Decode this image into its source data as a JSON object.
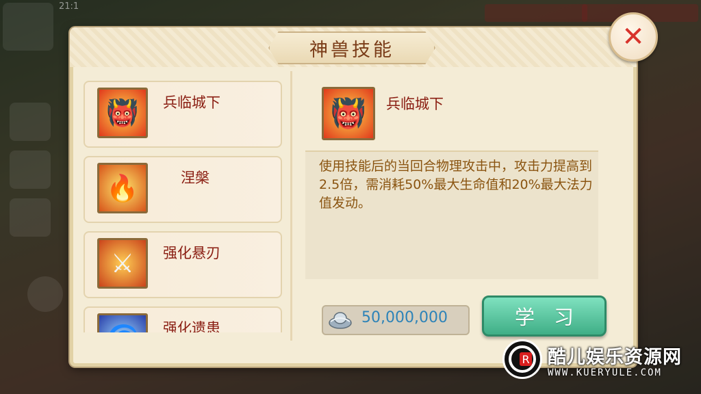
{
  "hud": {
    "time": "21:1"
  },
  "dialog": {
    "title": "神兽技能",
    "close_symbol": "✕"
  },
  "skills": [
    {
      "name": "兵临城下",
      "icon": "fire-demon-icon",
      "glyph": "👹"
    },
    {
      "name": "涅槃",
      "icon": "phoenix-icon",
      "glyph": "🔥"
    },
    {
      "name": "强化悬刃",
      "icon": "swords-icon",
      "glyph": "⚔"
    },
    {
      "name": "强化遗患",
      "icon": "blue-vortex-icon",
      "glyph": "🌀"
    }
  ],
  "detail": {
    "name": "兵临城下",
    "icon": "fire-demon-icon",
    "glyph": "👹",
    "description": "使用技能后的当回合物理攻击中，攻击力提高到2.5倍，需消耗50%最大生命值和20%最大法力值发动。"
  },
  "cost": {
    "icon": "silver-ingot-icon",
    "value": "50,000,000"
  },
  "learn_button": "学习",
  "watermark": {
    "title": "酷儿娱乐资源网",
    "url": "WWW.KUERYULE.COM",
    "logo_letter": "R"
  },
  "colors": {
    "accent_red": "#8a1e12",
    "desc_brown": "#8a5410",
    "cost_blue": "#2d83b8",
    "button_green": "#3fae86"
  }
}
